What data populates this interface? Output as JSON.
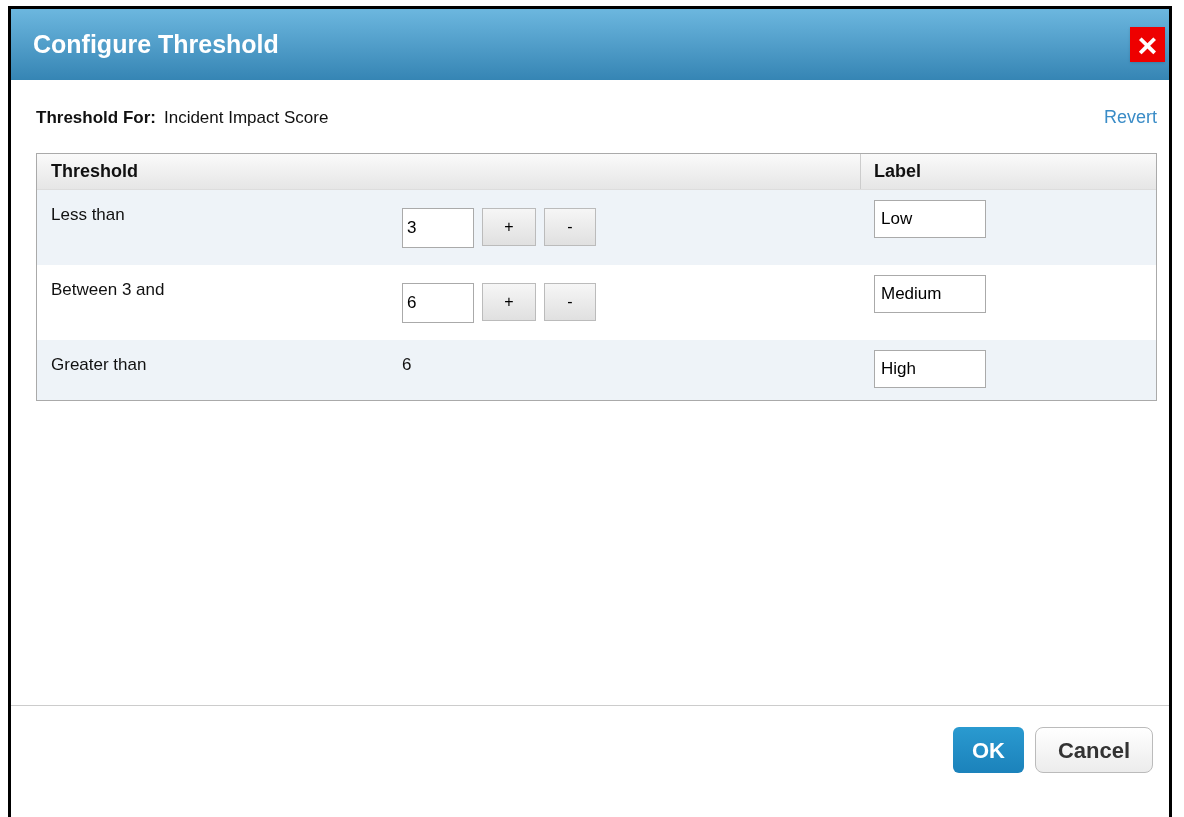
{
  "dialog": {
    "title": "Configure Threshold",
    "close": "×"
  },
  "threshold_for": {
    "label": "Threshold For:",
    "value": "Incident Impact Score"
  },
  "revert": "Revert",
  "table": {
    "columns": [
      "Threshold",
      "Label"
    ],
    "rows": [
      {
        "kind": "editable",
        "text": "Less than",
        "value": "3",
        "plus": "+",
        "minus": "-",
        "label": "Low"
      },
      {
        "kind": "editable",
        "text": "Between 3 and",
        "value": "6",
        "plus": "+",
        "minus": "-",
        "label": "Medium"
      },
      {
        "kind": "fixed",
        "text": "Greater than",
        "value": "6",
        "label": "High"
      }
    ]
  },
  "buttons": {
    "ok": "OK",
    "cancel": "Cancel"
  }
}
